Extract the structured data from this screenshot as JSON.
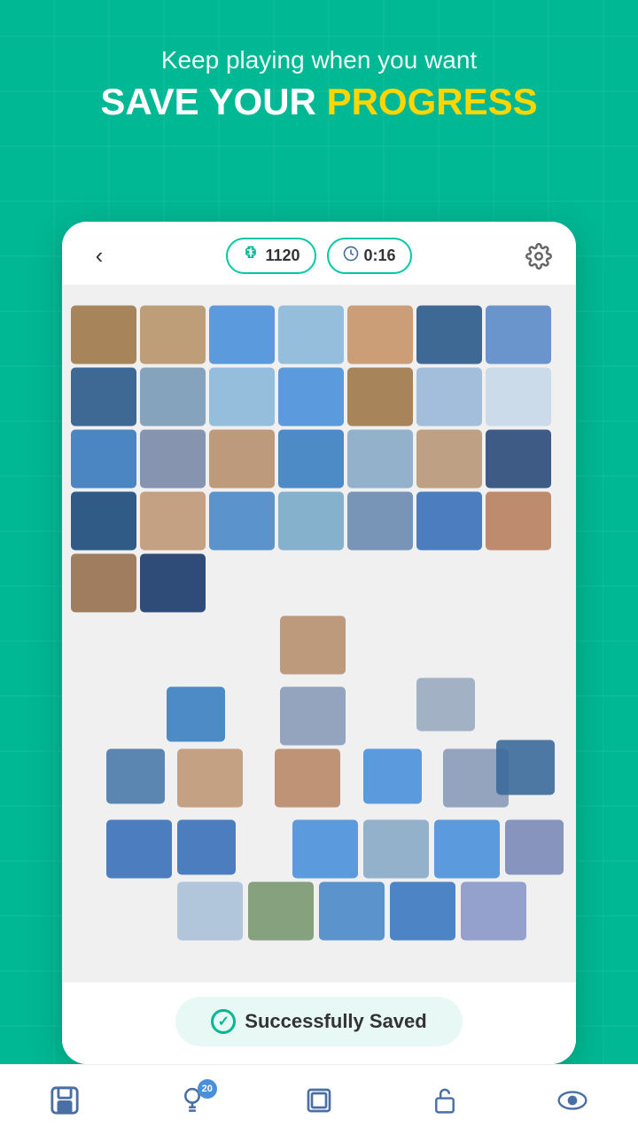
{
  "header": {
    "subtitle": "Keep playing when you want",
    "title_white": "SAVE YOUR",
    "title_yellow": "PROGRESS"
  },
  "topbar": {
    "back_label": "‹",
    "puzzle_count": "1120",
    "timer": "0:16"
  },
  "save_status": {
    "text": "Successfully Saved",
    "icon": "✓"
  },
  "bottom_nav": {
    "items": [
      {
        "name": "save",
        "icon": "💾",
        "badge": null
      },
      {
        "name": "hints",
        "icon": "💡",
        "badge": "20"
      },
      {
        "name": "layers",
        "icon": "⧉",
        "badge": null
      },
      {
        "name": "lock",
        "icon": "🔓",
        "badge": null
      },
      {
        "name": "eye",
        "icon": "👁",
        "badge": null
      }
    ]
  },
  "puzzle": {
    "pieces": [
      [
        "c-brown",
        "c-rock",
        "c-blue",
        "c-sky",
        "c-rock",
        "c-dark",
        "c-blue"
      ],
      [
        "c-dark",
        "c-sky",
        "c-mixed",
        "c-blue",
        "c-brown",
        "c-sky",
        "c-light"
      ],
      [
        "c-blue",
        "c-mixed",
        "c-rock",
        "c-blue",
        "c-sky",
        "c-brown",
        "c-dark"
      ],
      [
        "c-dark",
        "c-rock",
        "c-blue",
        "c-sky",
        "c-mixed",
        "c-blue",
        "c-rock"
      ],
      [
        "c-brown",
        "c-dark",
        "empty",
        "empty",
        "empty",
        "empty",
        "empty"
      ],
      [
        "empty",
        "empty",
        "c-rock",
        "empty",
        "empty",
        "c-sky",
        "empty"
      ],
      [
        "c-blue",
        "empty",
        "c-mixed",
        "empty",
        "empty",
        "empty",
        "empty"
      ],
      [
        "c-dark",
        "c-brown",
        "c-rock",
        "c-blue",
        "c-sky",
        "c-mixed",
        "empty"
      ],
      [
        "c-sky",
        "c-blue",
        "c-mixed",
        "c-sky",
        "c-rock",
        "c-dark",
        "c-blue"
      ],
      [
        "c-brown",
        "c-sky",
        "c-blue",
        "c-mixed",
        "c-rock",
        "c-sky",
        "c-light"
      ]
    ]
  },
  "colors": {
    "teal": "#00b894",
    "yellow": "#FFD600",
    "blue_pill": "#00c9a7",
    "save_bg": "#e8f8f4",
    "nav_blue": "#4a6fa5"
  }
}
